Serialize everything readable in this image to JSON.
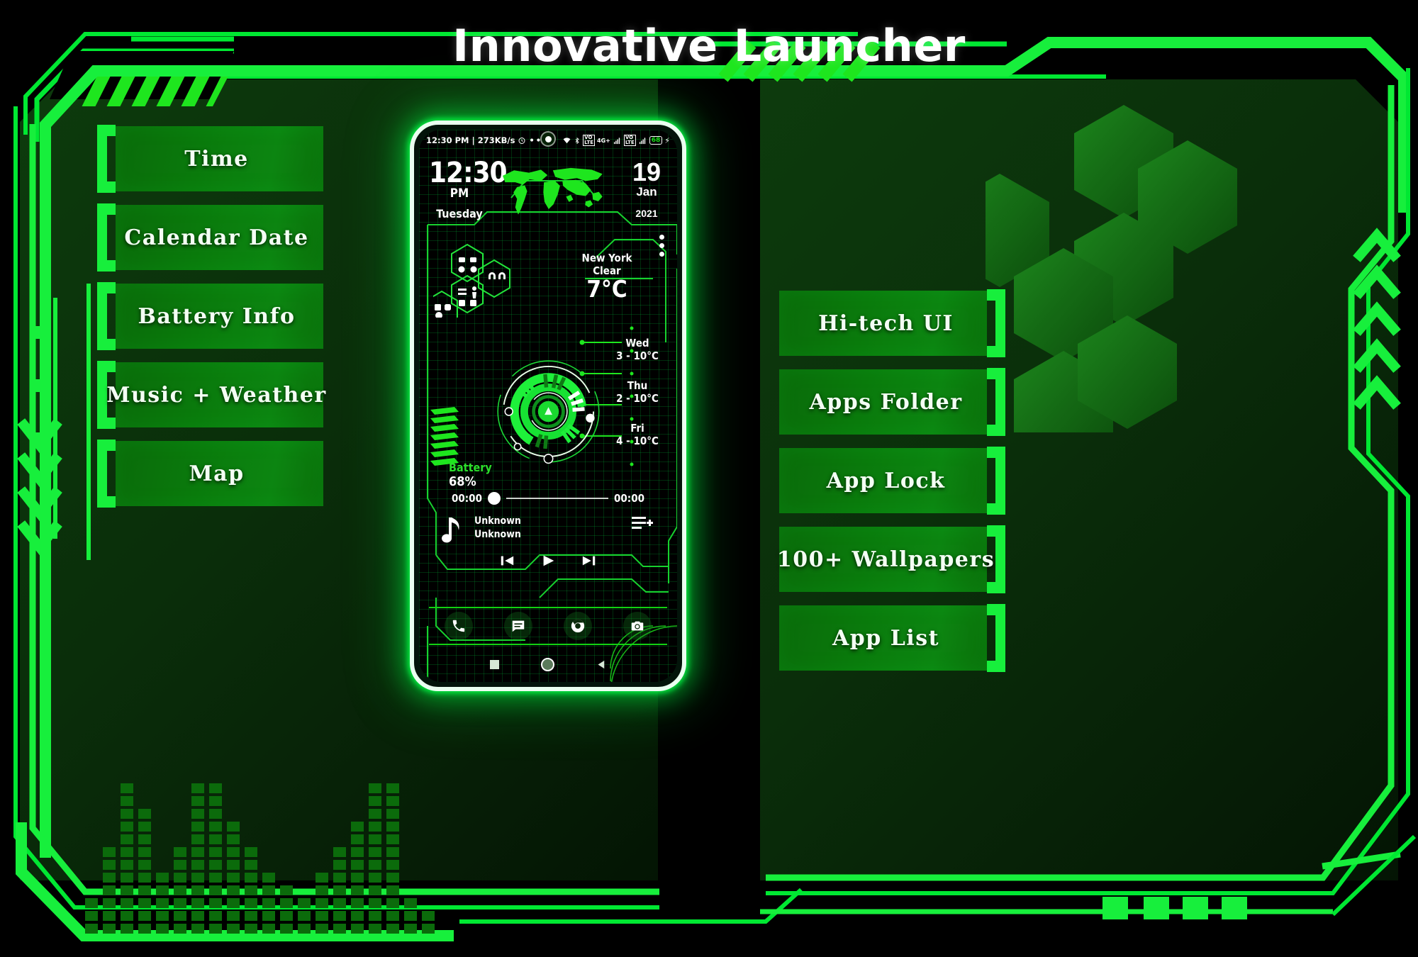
{
  "app": {
    "title": "Innovative Launcher",
    "accent": "#00e832",
    "accent_dark": "#0a7a0c",
    "text": "#ffffff"
  },
  "left_menu": {
    "items": [
      {
        "label": "Time"
      },
      {
        "label": "Calendar Date"
      },
      {
        "label": "Battery Info"
      },
      {
        "label": "Music + Weather"
      },
      {
        "label": "Map"
      }
    ]
  },
  "right_menu": {
    "items": [
      {
        "label": "Hi-tech UI"
      },
      {
        "label": "Apps Folder"
      },
      {
        "label": "App Lock"
      },
      {
        "label": "100+ Wallpapers"
      },
      {
        "label": "App List"
      }
    ]
  },
  "phone": {
    "status_bar": {
      "time": "12:30 PM",
      "separator": "|",
      "net_speed": "273KB/s",
      "alarm_icon": "alarm-icon",
      "overflow_icon": "more-dots-icon",
      "wifi_icon": "wifi-icon",
      "bluetooth_icon": "bluetooth-icon",
      "volte_icon_1": "volte-icon",
      "network_label": "4G+",
      "signal_icon_1": "signal-bars-icon",
      "volte_icon_2": "volte-icon",
      "signal_icon_2": "signal-bars-icon",
      "battery_level": "68",
      "charging_icon": "bolt-icon"
    },
    "clock_widget": {
      "time": "12:30",
      "meridiem": "PM",
      "weekday": "Tuesday",
      "day": "19",
      "month": "Jan",
      "year": "2021",
      "map_icon": "world-map-icon"
    },
    "weather": {
      "city": "New York",
      "condition": "Clear",
      "temperature": "7°C"
    },
    "forecast": [
      {
        "day": "Wed",
        "range": "3 - 10°C"
      },
      {
        "day": "Thu",
        "range": "2 - 10°C"
      },
      {
        "day": "Fri",
        "range": "4 - 10°C"
      }
    ],
    "battery": {
      "label": "Battery",
      "value": "68%"
    },
    "music_player": {
      "elapsed": "00:00",
      "duration": "00:00",
      "title": "Unknown",
      "artist": "Unknown",
      "note_icon": "music-note-icon",
      "playlist_add_icon": "playlist-add-icon",
      "prev_icon": "skip-previous-icon",
      "play_icon": "play-icon",
      "next_icon": "skip-next-icon"
    },
    "dock": [
      {
        "icon": "phone-icon"
      },
      {
        "icon": "messages-icon"
      },
      {
        "icon": "chrome-icon"
      },
      {
        "icon": "camera-icon"
      }
    ],
    "navbar": [
      {
        "icon": "recents-square-icon"
      },
      {
        "icon": "home-circle-icon"
      },
      {
        "icon": "back-triangle-icon"
      }
    ],
    "app_folders": [
      {
        "name": "media-folder-hex"
      },
      {
        "name": "headphones-folder-hex"
      },
      {
        "name": "tools-folder-hex"
      },
      {
        "name": "social-folder-hex"
      }
    ],
    "gauge_icon": "hud-dial-icon",
    "overflow_menu_icon": "vertical-dots-icon"
  },
  "decor": {
    "hazard_stripes": "hazard-stripes",
    "hex_cluster": "hexagon-cluster",
    "chevrons_left": "chevron-down-group",
    "chevrons_right": "chevron-up-group",
    "equalizer": "equalizer-bars",
    "corner_squares": "corner-square-group",
    "eq_heights": [
      3,
      7,
      12,
      10,
      5,
      7,
      12,
      12,
      9,
      7,
      5,
      4,
      3,
      5,
      7,
      9,
      12,
      12,
      3,
      2
    ]
  }
}
